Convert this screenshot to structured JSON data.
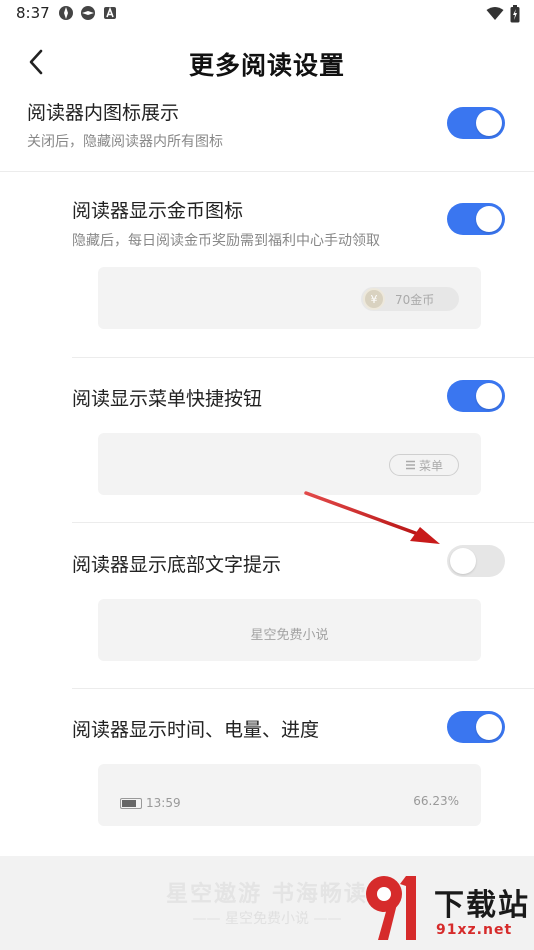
{
  "status_bar": {
    "time": "8:37",
    "left_icons": [
      "app-icon-1",
      "app-icon-2",
      "a-icon"
    ],
    "right_icons": [
      "wifi-icon",
      "battery-charging-icon"
    ]
  },
  "header": {
    "title": "更多阅读设置",
    "back_icon": "chevron-left-icon"
  },
  "settings": [
    {
      "title": "阅读器内图标展示",
      "subtitle": "关闭后，隐藏阅读器内所有图标",
      "enabled": true
    },
    {
      "title": "阅读器显示金币图标",
      "subtitle": "隐藏后，每日阅读金币奖励需到福利中心手动领取",
      "enabled": true,
      "preview": {
        "coin_symbol": "¥",
        "coin_text": "70金币"
      }
    },
    {
      "title": "阅读显示菜单快捷按钮",
      "enabled": true,
      "preview": {
        "menu_text": "菜单"
      }
    },
    {
      "title": "阅读器显示底部文字提示",
      "enabled": false,
      "preview": {
        "hint_text": "星空免费小说"
      }
    },
    {
      "title": "阅读器显示时间、电量、进度",
      "enabled": true,
      "preview": {
        "time_text": "13:59",
        "progress_text": "66.23%"
      }
    }
  ],
  "footer": {
    "main": "星空遨游 书海畅读",
    "sub": "—— 星空免费小说 ——"
  },
  "watermark": {
    "brand": "下载站",
    "url": "91xz.net"
  },
  "colors": {
    "accent": "#3a76f0",
    "toggle_off": "#e6e6e6",
    "arrow": "#d32020"
  }
}
